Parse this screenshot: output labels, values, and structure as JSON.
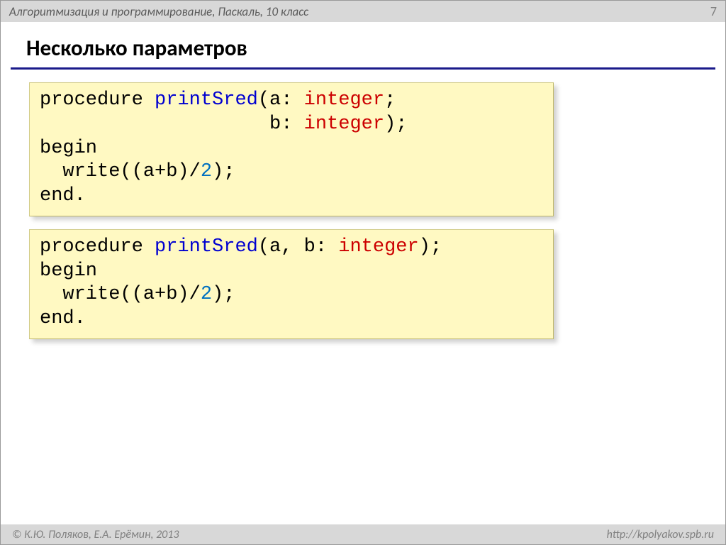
{
  "header": {
    "subject": "Алгоритмизация и программирование, Паскаль, 10 класс",
    "page": "7"
  },
  "title": "Несколько параметров",
  "code1": {
    "t1a": "procedure ",
    "t1b": "printSred",
    "t1c": "(a: ",
    "t1d": "integer",
    "t1e": ";",
    "t2a": "                    b: ",
    "t2b": "integer",
    "t2c": ");",
    "t3": "begin",
    "t4a": "  write((a+b)/",
    "t4b": "2",
    "t4c": ");",
    "t5": "end."
  },
  "code2": {
    "t1a": "procedure ",
    "t1b": "printSred",
    "t1c": "(a, b: ",
    "t1d": "integer",
    "t1e": ");",
    "t2": "begin",
    "t3a": "  write((a+b)/",
    "t3b": "2",
    "t3c": ");",
    "t4": "end."
  },
  "footer": {
    "copyright": "© К.Ю. Поляков, Е.А. Ерёмин, 2013",
    "url": "http://kpolyakov.spb.ru"
  }
}
